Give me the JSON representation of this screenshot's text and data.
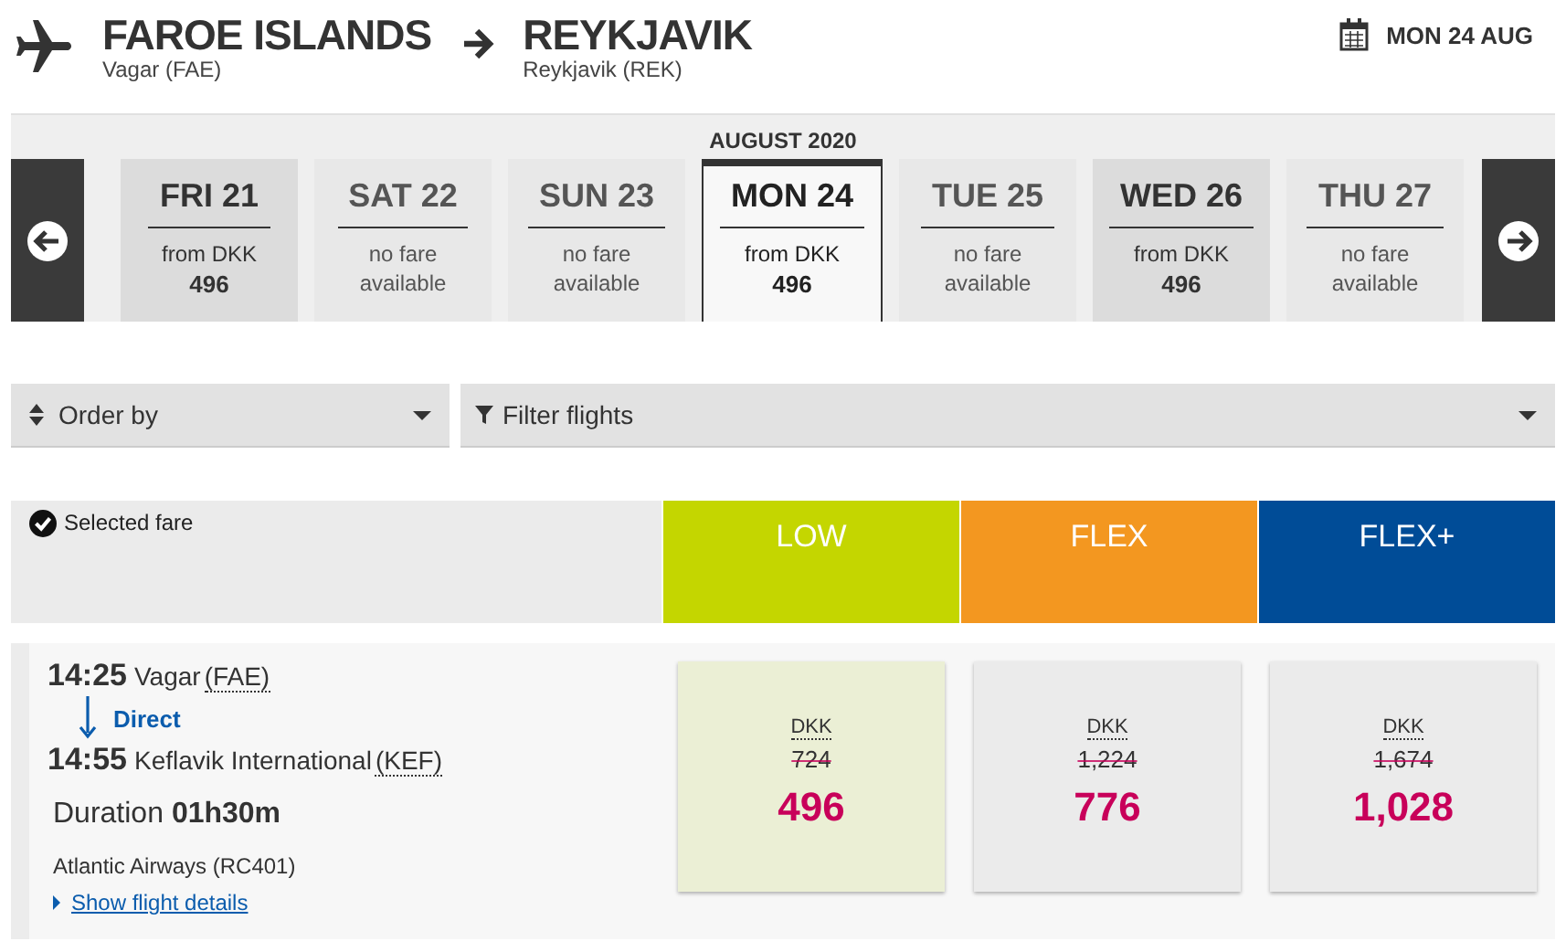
{
  "route": {
    "origin": {
      "city": "FAROE ISLANDS",
      "airport": "Vagar (FAE)"
    },
    "destination": {
      "city": "REYKJAVIK",
      "airport": "Reykjavik (REK)"
    },
    "date": "MON 24 AUG"
  },
  "calendar": {
    "month": "AUGUST 2020",
    "days": [
      {
        "label": "FRI 21",
        "kind": "fare",
        "line1": "from DKK",
        "line2": "496",
        "selected": false
      },
      {
        "label": "SAT 22",
        "kind": "none",
        "line1": "no fare",
        "line2": "available",
        "selected": false
      },
      {
        "label": "SUN 23",
        "kind": "none",
        "line1": "no fare",
        "line2": "available",
        "selected": false
      },
      {
        "label": "MON 24",
        "kind": "fare",
        "line1": "from DKK",
        "line2": "496",
        "selected": true
      },
      {
        "label": "TUE 25",
        "kind": "none",
        "line1": "no fare",
        "line2": "available",
        "selected": false
      },
      {
        "label": "WED 26",
        "kind": "fare",
        "line1": "from DKK",
        "line2": "496",
        "selected": false
      },
      {
        "label": "THU 27",
        "kind": "none",
        "line1": "no fare",
        "line2": "available",
        "selected": false
      }
    ]
  },
  "order_by": {
    "label": "Order by"
  },
  "filter": {
    "label": "Filter flights"
  },
  "legend": {
    "label": "Selected fare"
  },
  "fare_types": [
    {
      "label": "LOW",
      "color": "#c4d600"
    },
    {
      "label": "FLEX",
      "color": "#f39720"
    },
    {
      "label": "FLEX+",
      "color": "#004c97"
    }
  ],
  "flight": {
    "departure_time": "14:25",
    "departure_airport": "Vagar",
    "departure_code": "(FAE)",
    "stops": "Direct",
    "arrival_time": "14:55",
    "arrival_airport": "Keflavik International",
    "arrival_code": "(KEF)",
    "duration_label": "Duration",
    "duration": "01h30m",
    "carrier": "Atlantic Airways (RC401)",
    "details_link": "Show flight details",
    "fares": [
      {
        "currency": "DKK",
        "old_price": "724",
        "price": "496",
        "selected": true
      },
      {
        "currency": "DKK",
        "old_price": "1,224",
        "price": "776",
        "selected": false
      },
      {
        "currency": "DKK",
        "old_price": "1,674",
        "price": "1,028",
        "selected": false
      }
    ]
  }
}
